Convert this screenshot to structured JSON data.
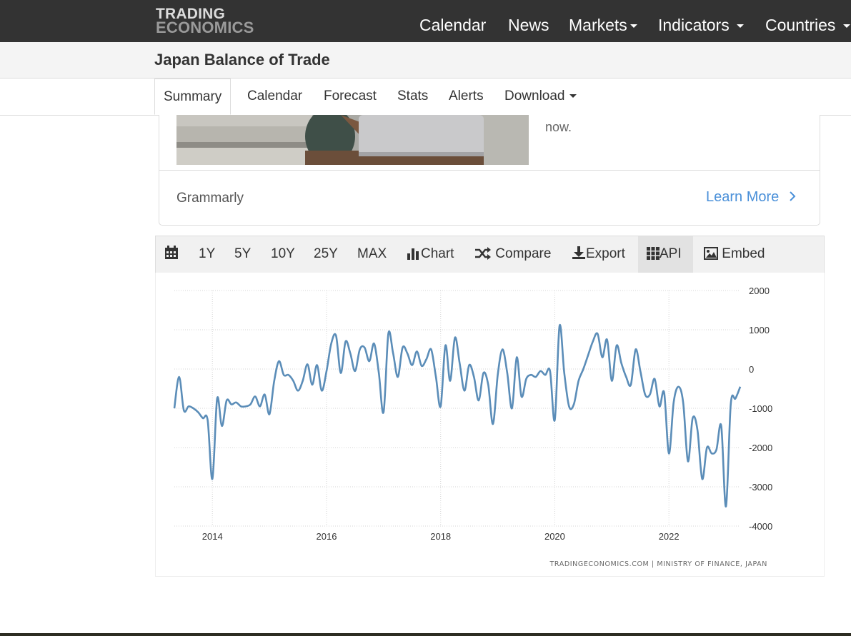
{
  "nav": {
    "logo_line1": "TRADING",
    "logo_line2": "ECONOMICS",
    "items": [
      {
        "label": "Calendar"
      },
      {
        "label": "News"
      },
      {
        "label": "Markets"
      },
      {
        "label": "Indicators"
      },
      {
        "label": "Countries"
      }
    ]
  },
  "header": {
    "title": "Japan Balance of Trade"
  },
  "tabs": [
    {
      "label": "Summary",
      "active": true
    },
    {
      "label": "Calendar"
    },
    {
      "label": "Forecast"
    },
    {
      "label": "Stats"
    },
    {
      "label": "Alerts"
    },
    {
      "label": "Download"
    }
  ],
  "ad": {
    "text_fragment": "now.",
    "brand": "Grammarly",
    "cta": "Learn More"
  },
  "toolbar": {
    "calendar_icon": "calendar-icon",
    "ranges": [
      "1Y",
      "5Y",
      "10Y",
      "25Y",
      "MAX"
    ],
    "chart_label": "Chart",
    "compare_label": "Compare",
    "export_label": "Export",
    "api_label": "API",
    "embed_label": "Embed"
  },
  "colors": {
    "nav_bg": "#333333",
    "line": "#5b8db8",
    "link": "#4a90d9"
  },
  "chart_data": {
    "type": "line",
    "title": "",
    "xlabel": "",
    "ylabel": "",
    "xlim": [
      "2013-05",
      "2023-04"
    ],
    "ylim": [
      -4000,
      2000
    ],
    "yticks": [
      2000,
      1000,
      0,
      -1000,
      -2000,
      -3000,
      -4000
    ],
    "xticks": [
      "2014",
      "2016",
      "2018",
      "2020",
      "2022"
    ],
    "y_axis_position": "right",
    "grid": true,
    "source": "TRADINGECONOMICS.COM | MINISTRY OF FINANCE, JAPAN",
    "series": [
      {
        "color": "#5b8db8",
        "x": [
          "2013-05",
          "2013-06",
          "2013-07",
          "2013-08",
          "2013-09",
          "2013-10",
          "2013-11",
          "2013-12",
          "2014-01",
          "2014-02",
          "2014-03",
          "2014-04",
          "2014-05",
          "2014-06",
          "2014-07",
          "2014-08",
          "2014-09",
          "2014-10",
          "2014-11",
          "2014-12",
          "2015-01",
          "2015-02",
          "2015-03",
          "2015-04",
          "2015-05",
          "2015-06",
          "2015-07",
          "2015-08",
          "2015-09",
          "2015-10",
          "2015-11",
          "2015-12",
          "2016-01",
          "2016-02",
          "2016-03",
          "2016-04",
          "2016-05",
          "2016-06",
          "2016-07",
          "2016-08",
          "2016-09",
          "2016-10",
          "2016-11",
          "2016-12",
          "2017-01",
          "2017-02",
          "2017-03",
          "2017-04",
          "2017-05",
          "2017-06",
          "2017-07",
          "2017-08",
          "2017-09",
          "2017-10",
          "2017-11",
          "2017-12",
          "2018-01",
          "2018-02",
          "2018-03",
          "2018-04",
          "2018-05",
          "2018-06",
          "2018-07",
          "2018-08",
          "2018-09",
          "2018-10",
          "2018-11",
          "2018-12",
          "2019-01",
          "2019-02",
          "2019-03",
          "2019-04",
          "2019-05",
          "2019-06",
          "2019-07",
          "2019-08",
          "2019-09",
          "2019-10",
          "2019-11",
          "2019-12",
          "2020-01",
          "2020-02",
          "2020-03",
          "2020-04",
          "2020-05",
          "2020-06",
          "2020-07",
          "2020-08",
          "2020-09",
          "2020-10",
          "2020-11",
          "2020-12",
          "2021-01",
          "2021-02",
          "2021-03",
          "2021-04",
          "2021-05",
          "2021-06",
          "2021-07",
          "2021-08",
          "2021-09",
          "2021-10",
          "2021-11",
          "2021-12",
          "2022-01",
          "2022-02",
          "2022-03",
          "2022-04",
          "2022-05",
          "2022-06",
          "2022-07",
          "2022-08",
          "2022-09",
          "2022-10",
          "2022-11",
          "2022-12",
          "2023-01",
          "2023-02",
          "2023-03",
          "2023-04"
        ],
        "values": [
          -1000,
          -200,
          -1050,
          -950,
          -1000,
          -1100,
          -1250,
          -1300,
          -2800,
          -750,
          -1450,
          -800,
          -900,
          -850,
          -950,
          -950,
          -900,
          -700,
          -950,
          -650,
          -1150,
          -300,
          200,
          -150,
          -150,
          -300,
          -550,
          -300,
          120,
          -400,
          100,
          -550,
          -50,
          650,
          850,
          -100,
          700,
          400,
          -50,
          500,
          550,
          200,
          650,
          -100,
          -1100,
          900,
          400,
          -200,
          550,
          400,
          100,
          450,
          80,
          250,
          500,
          -200,
          -950,
          600,
          -300,
          800,
          150,
          -550,
          100,
          -200,
          -800,
          -100,
          -400,
          -1400,
          -150,
          500,
          -100,
          -1000,
          300,
          -700,
          -250,
          -150,
          -200,
          -50,
          -150,
          -50,
          -1300,
          1100,
          -100,
          -950,
          -900,
          -300,
          0,
          350,
          700,
          900,
          300,
          750,
          -300,
          600,
          150,
          -200,
          -400,
          500,
          -50,
          -650,
          -650,
          -250,
          -950,
          -600,
          -2150,
          -850,
          -450,
          -850,
          -2350,
          -1250,
          -1550,
          -2800,
          -2000,
          -2150,
          -2050,
          -1450,
          -3500,
          -900,
          -750,
          -450
        ]
      }
    ]
  }
}
